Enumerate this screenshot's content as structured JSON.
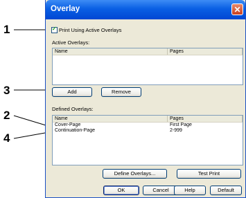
{
  "callouts": [
    "1",
    "3",
    "2",
    "4"
  ],
  "window": {
    "title": "Overlay"
  },
  "options": {
    "print_active_overlays_label": "Print Using Active Overlays",
    "print_active_overlays_checked": true
  },
  "active_overlays": {
    "label": "Active Overlays:",
    "columns": [
      "Name",
      "Pages"
    ],
    "rows": []
  },
  "active_buttons": {
    "add": "Add",
    "remove": "Remove"
  },
  "defined_overlays": {
    "label": "Defined Overlays:",
    "columns": [
      "Name",
      "Pages"
    ],
    "rows": [
      {
        "name": "Cover-Page",
        "pages": "First Page"
      },
      {
        "name": "Continuation-Page",
        "pages": "2-999"
      }
    ]
  },
  "defined_buttons": {
    "define": "Define Overlays...",
    "test_print": "Test Print"
  },
  "footer_buttons": {
    "ok": "OK",
    "cancel": "Cancel",
    "help": "Help",
    "default": "Default"
  },
  "icons": {
    "close": "close-icon",
    "check": "checkmark-icon"
  }
}
